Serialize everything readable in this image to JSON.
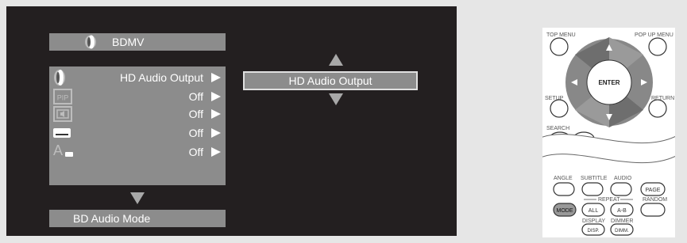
{
  "top_bar": {
    "label": "BDMV"
  },
  "menu_rows": [
    {
      "value": "HD Audio Output",
      "icon": "speaker-icon"
    },
    {
      "value": "Off",
      "icon": "pip-icon"
    },
    {
      "value": "Off",
      "icon": "secondary-audio-icon"
    },
    {
      "value": "Off",
      "icon": "subtitle-icon"
    },
    {
      "value": "Off",
      "icon": "subtitle-style-icon"
    }
  ],
  "pip_icon_text": "PIP",
  "subtitle_style_letter": "A",
  "selection": {
    "label": "HD Audio Output"
  },
  "bottom_bar": {
    "label": "BD Audio Mode"
  },
  "remote": {
    "top_menu": "TOP MENU",
    "popup_menu": "POP UP MENU",
    "enter": "ENTER",
    "setup": "SETUP",
    "return": "RETURN",
    "search": "SEARCH",
    "angle": "ANGLE",
    "subtitle": "SUBTITLE",
    "audio": "AUDIO",
    "page": "PAGE",
    "repeat": "REPEAT",
    "random": "RANDOM",
    "mode": "MODE",
    "all": "ALL",
    "ab": "A-B",
    "display": "DISPLAY",
    "dimmer": "DIMMER",
    "disp": "DISP.",
    "dimm": "DIMM."
  },
  "colors": {
    "screen_bg": "#231f20",
    "panel": "#8c8c8c",
    "arrow": "#a8a8a8",
    "page_bg": "#e6e6e6"
  }
}
